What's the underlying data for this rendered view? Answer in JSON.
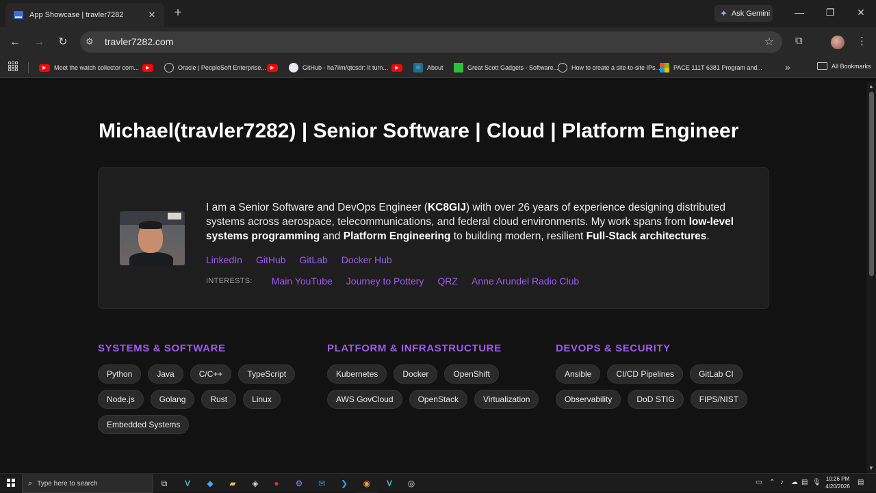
{
  "browser": {
    "tab": {
      "title": "App Showcase | travler7282",
      "close_label": "✕"
    },
    "new_tab_label": "+",
    "gemini_label": "Ask Gemini",
    "url": "travler7282.com",
    "bookmarks": [
      {
        "label": "Meet the watch collector com...",
        "icon": "youtube-icon"
      },
      {
        "label": "",
        "icon": "youtube-icon"
      },
      {
        "label": "Oracle | PeopleSoft Enterprise...",
        "icon": "globe-icon"
      },
      {
        "label": "",
        "icon": "youtube-icon"
      },
      {
        "label": "GitHub - ha7ilm/qtcsdr: It turn...",
        "icon": "github-icon"
      },
      {
        "label": "",
        "icon": "youtube-icon"
      },
      {
        "label": "About",
        "icon": "react-icon"
      },
      {
        "label": "Great Scott Gadgets - Software...",
        "icon": "gsg-icon"
      },
      {
        "label": "How to create a site-to-site IPs...",
        "icon": "globe-icon"
      },
      {
        "label": "PACE 111T 6381 Program and...",
        "icon": "microsoft-icon"
      }
    ],
    "all_bookmarks_label": "All Bookmarks"
  },
  "page": {
    "headline": "Michael(travler7282) | Senior Software | Cloud | Platform Engineer",
    "bio": {
      "t1": "I am a Senior Software and DevOps Engineer (",
      "b1": "KC8GIJ",
      "t2": ") with over 26 years of experience designing distributed systems across aerospace, telecommunications, and federal cloud environments. My work spans from ",
      "b2": "low-level systems programming",
      "t3": " and ",
      "b3": "Platform Engineering",
      "t4": " to building modern, resilient ",
      "b4": "Full-Stack architectures",
      "t5": "."
    },
    "links": [
      "LinkedIn",
      "GitHub",
      "GitLab",
      "Docker Hub"
    ],
    "interests_label": "INTERESTS:",
    "interests": [
      "Main YouTube",
      "Journey to Pottery",
      "QRZ",
      "Anne Arundel Radio Club"
    ],
    "skills": [
      {
        "heading": "SYSTEMS & SOFTWARE",
        "chips": [
          "Python",
          "Java",
          "C/C++",
          "TypeScript",
          "Node.js",
          "Golang",
          "Rust",
          "Linux",
          "Embedded Systems"
        ]
      },
      {
        "heading": "PLATFORM & INFRASTRUCTURE",
        "chips": [
          "Kubernetes",
          "Docker",
          "OpenShift",
          "AWS GovCloud",
          "OpenStack",
          "Virtualization"
        ]
      },
      {
        "heading": "DEVOPS & SECURITY",
        "chips": [
          "Ansible",
          "CI/CD Pipelines",
          "GitLab CI",
          "Observability",
          "DoD STIG",
          "FIPS/NIST"
        ]
      }
    ],
    "accent_color": "#a259f0"
  },
  "taskbar": {
    "search_placeholder": "Type here to search",
    "time": "10:26 PM",
    "date": "4/20/2026"
  }
}
